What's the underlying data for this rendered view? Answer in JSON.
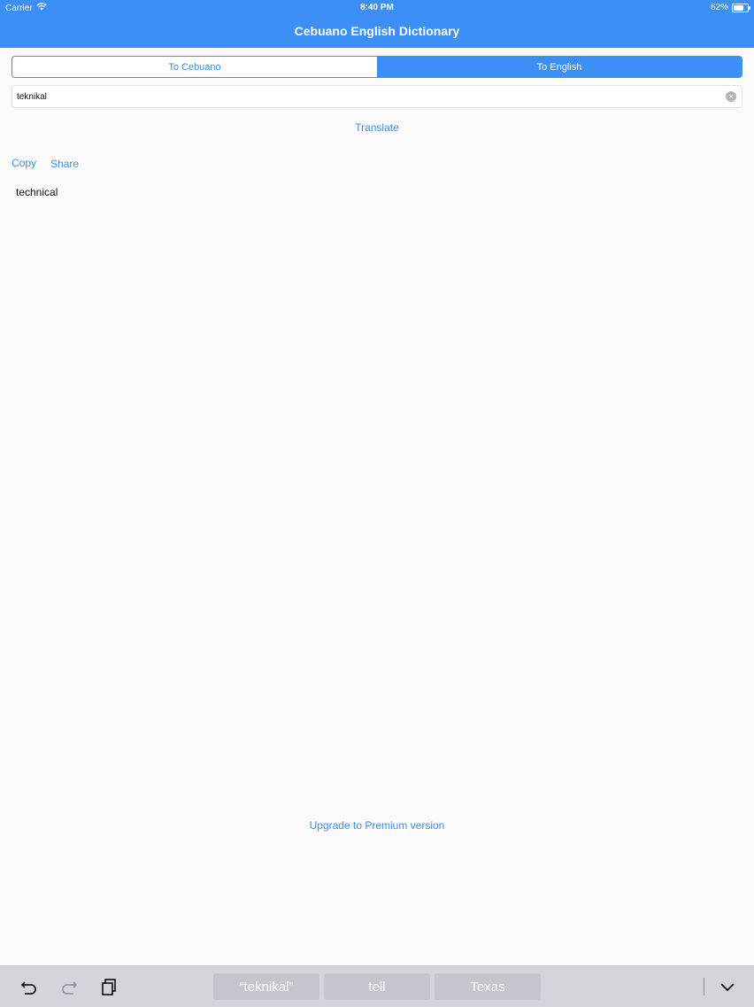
{
  "status": {
    "carrier": "Carrier",
    "time": "8:40 PM",
    "battery": "62%"
  },
  "header": {
    "title": "Cebuano English Dictionary"
  },
  "segmented": {
    "options": [
      "To Cebuano",
      "To English"
    ],
    "selected": "To English"
  },
  "search": {
    "value": "teknikal"
  },
  "actions": {
    "translate": "Translate",
    "copy": "Copy",
    "share": "Share"
  },
  "result": {
    "text": "technical"
  },
  "footer": {
    "upgrade": "Upgrade to Premium version"
  },
  "keyboard": {
    "suggestions": [
      "“teknikal”",
      "tell",
      "Texas"
    ]
  },
  "icons": {
    "wifi": "wifi-icon",
    "battery": "battery-icon",
    "clear": "clear-icon",
    "undo": "undo-icon",
    "redo": "redo-icon",
    "paste": "paste-icon",
    "dismiss": "chevron-down-icon"
  },
  "colors": {
    "accent": "#3b8ff6",
    "keyboard_bar": "#d2d5da"
  }
}
